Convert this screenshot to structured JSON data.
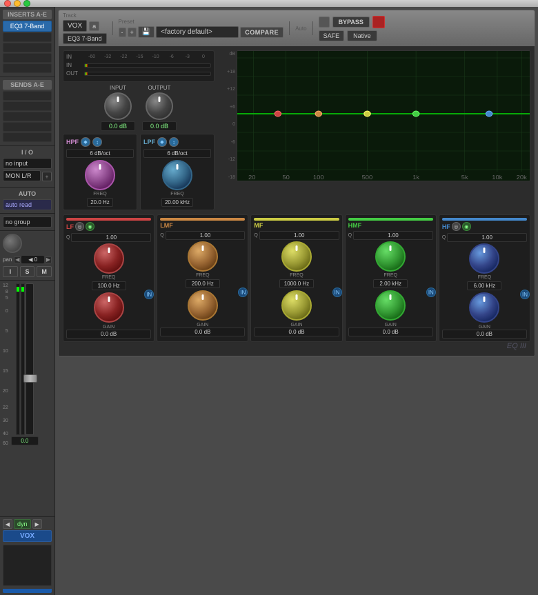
{
  "titleBar": {
    "buttons": [
      "close",
      "minimize",
      "maximize"
    ]
  },
  "sidebar": {
    "insertsLabel": "INSERTS A-E",
    "insertSlot": "EQ3 7-Band",
    "sendsLabel": "SENDS A-E",
    "ioLabel": "I / O",
    "inputLabel": "no input",
    "outputLabel": "MON L/R",
    "autoLabel": "AUTO",
    "autoValue": "auto read",
    "groupLabel": "no group",
    "panLabel": "pan",
    "panValue": "◀ 0",
    "iBtn": "I",
    "sBtn": "S",
    "mBtn": "M",
    "faderDb": "0.0",
    "transportBtns": [
      "◀",
      "dyn",
      "▶"
    ],
    "channelName": "VOX"
  },
  "plugin": {
    "track": {
      "label": "Track",
      "name": "VOX",
      "btn": "a"
    },
    "preset": {
      "label": "Preset",
      "value": "<factory default>",
      "leftArrow": "-",
      "rightArrow": "+",
      "saveIcon": "💾",
      "compareLabel": "COMPARE"
    },
    "auto": {
      "label": "Auto"
    },
    "bypass": "BYPASS",
    "safe": "SAFE",
    "native": "Native",
    "pluginName": "EQ3 7-Band",
    "input": {
      "label": "INPUT",
      "value": "0.0 dB"
    },
    "output": {
      "label": "OUTPUT",
      "value": "0.0 dB"
    },
    "meterScale": [
      "-60",
      "-32",
      "-22",
      "-16",
      "-10",
      "-6",
      "-3",
      "0"
    ],
    "inLabel": "IN",
    "outLabel": "OUT",
    "graph": {
      "dbLabels": [
        "+18",
        "+12",
        "+6",
        "0",
        "-6",
        "-12",
        "-18"
      ],
      "freqLabels": [
        "20",
        "50",
        "100",
        "500",
        "1k",
        "5k",
        "10k",
        "20k"
      ]
    },
    "hpf": {
      "label": "HPF",
      "slope": "6 dB/oct",
      "freq": "20.0 Hz",
      "enabled": true
    },
    "lpf": {
      "label": "LPF",
      "slope": "6 dB/oct",
      "freq": "20.00 kHz",
      "enabled": true
    },
    "bands": [
      {
        "id": "LF",
        "label": "LF",
        "color": "#cc4444",
        "q": "1.00",
        "freq": "100.0 Hz",
        "gain": "0.0 dB"
      },
      {
        "id": "LMF",
        "label": "LMF",
        "color": "#cc8844",
        "q": "1.00",
        "freq": "200.0 Hz",
        "gain": "0.0 dB"
      },
      {
        "id": "MF",
        "label": "MF",
        "color": "#cccc44",
        "q": "1.00",
        "freq": "1000.0 Hz",
        "gain": "0.0 dB"
      },
      {
        "id": "HMF",
        "label": "HMF",
        "color": "#44cc44",
        "q": "1.00",
        "freq": "2.00 kHz",
        "gain": "0.0 dB"
      },
      {
        "id": "HF",
        "label": "HF",
        "color": "#4488cc",
        "q": "1.00",
        "freq": "6.00 kHz",
        "gain": "0.0 dB"
      }
    ],
    "eqIII": "EQ III"
  }
}
